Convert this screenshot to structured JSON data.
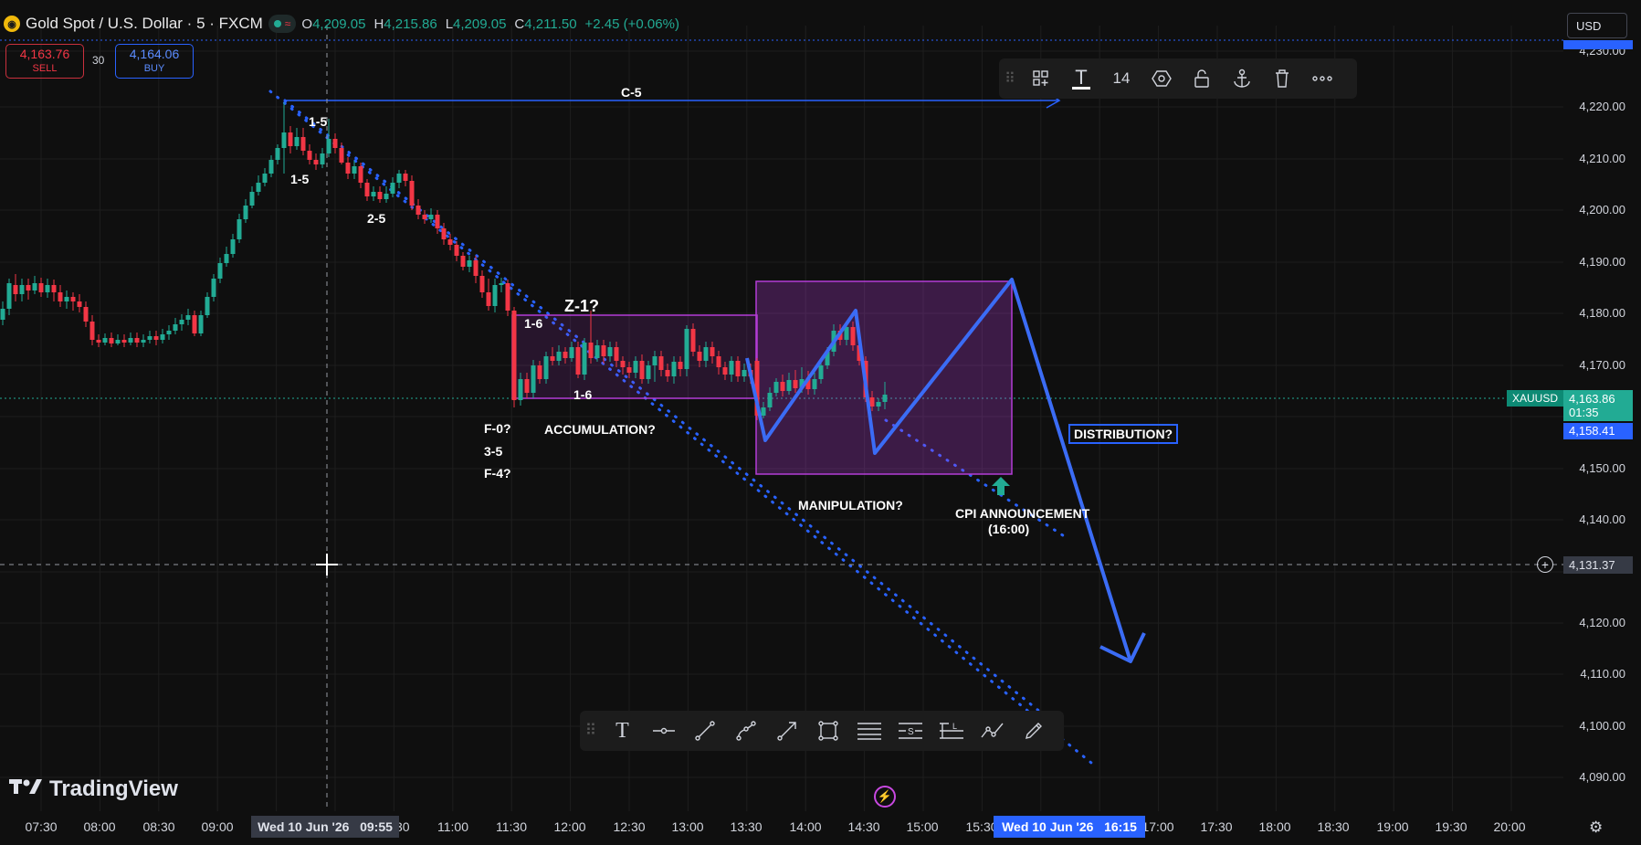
{
  "header": {
    "symbol_icon": "gold-coin-icon",
    "title": "Gold Spot / U.S. Dollar · 5 · FXCM",
    "live_wave": "≈",
    "ohlc": [
      {
        "key": "O",
        "value": "4,209.05"
      },
      {
        "key": "H",
        "value": "4,215.86"
      },
      {
        "key": "L",
        "value": "4,209.05"
      },
      {
        "key": "C",
        "value": "4,211.50"
      }
    ],
    "change": "+2.45 (+0.06%)"
  },
  "trade": {
    "sell_price": "4,163.76",
    "sell_label": "SELL",
    "spread": "30",
    "buy_price": "4,164.06",
    "buy_label": "BUY"
  },
  "currency": "USD",
  "top_toolbar": {
    "icons": [
      "drag-handle-icon",
      "add-to-layout-icon",
      "text-color-icon",
      "font-size",
      "settings-hexagon-icon",
      "lock-icon",
      "anchor-icon",
      "trash-icon",
      "more-icon"
    ],
    "font_size": "14"
  },
  "bottom_toolbar": {
    "icons": [
      "drag-handle-icon",
      "text-tool-icon",
      "horizontal-ray-icon",
      "trend-line-icon",
      "curve-icon",
      "arrow-line-icon",
      "rectangle-icon",
      "parallel-channel-icon",
      "fib-retracement-icon",
      "long-position-icon",
      "pattern-icon",
      "brush-icon"
    ]
  },
  "price_axis": [
    "4,230.00",
    "4,220.00",
    "4,210.00",
    "4,200.00",
    "4,190.00",
    "4,180.00",
    "4,170.00",
    "4,150.00",
    "4,140.00",
    "4,120.00",
    "4,110.00",
    "4,100.00",
    "4,090.00"
  ],
  "time_axis": [
    "07:30",
    "08:00",
    "08:30",
    "09:00",
    "10:30",
    "11:00",
    "11:30",
    "12:00",
    "12:30",
    "13:00",
    "13:30",
    "14:00",
    "14:30",
    "15:00",
    "15:30",
    "17:00",
    "17:30",
    "18:00",
    "18:30",
    "19:00",
    "19:30",
    "20:00"
  ],
  "crosshair": {
    "date": "Wed 10 Jun '26",
    "time": "09:55",
    "price": "4,131.37"
  },
  "time_pill": {
    "date": "Wed 10 Jun '26",
    "time": "16:15"
  },
  "symbol_badge": "XAUUSD",
  "last_price": "4,163.86",
  "countdown": "01:35",
  "line_price": "4,158.41",
  "annotations": {
    "c5": "C-5",
    "wave_1_5_top": "1-5",
    "wave_1_5_low": "1-5",
    "wave_2_5": "2-5",
    "z1": "Z-1?",
    "wave_1_6_top": "1-6",
    "wave_1_6_bottom": "1-6",
    "f0": "F-0?",
    "w35": "3-5",
    "f4": "F-4?",
    "accumulation": "ACCUMULATION?",
    "manipulation": "MANIPULATION?",
    "distribution": "DISTRIBUTION?",
    "cpi": "CPI ANNOUNCEMENT",
    "cpi_time": "(16:00)"
  },
  "brand": "TradingView",
  "colors": {
    "background": "#0f0f0f",
    "bull": "#22ab94",
    "bear": "#f23645",
    "accent_blue": "#2962ff",
    "box_purple": "#b43dd6"
  }
}
